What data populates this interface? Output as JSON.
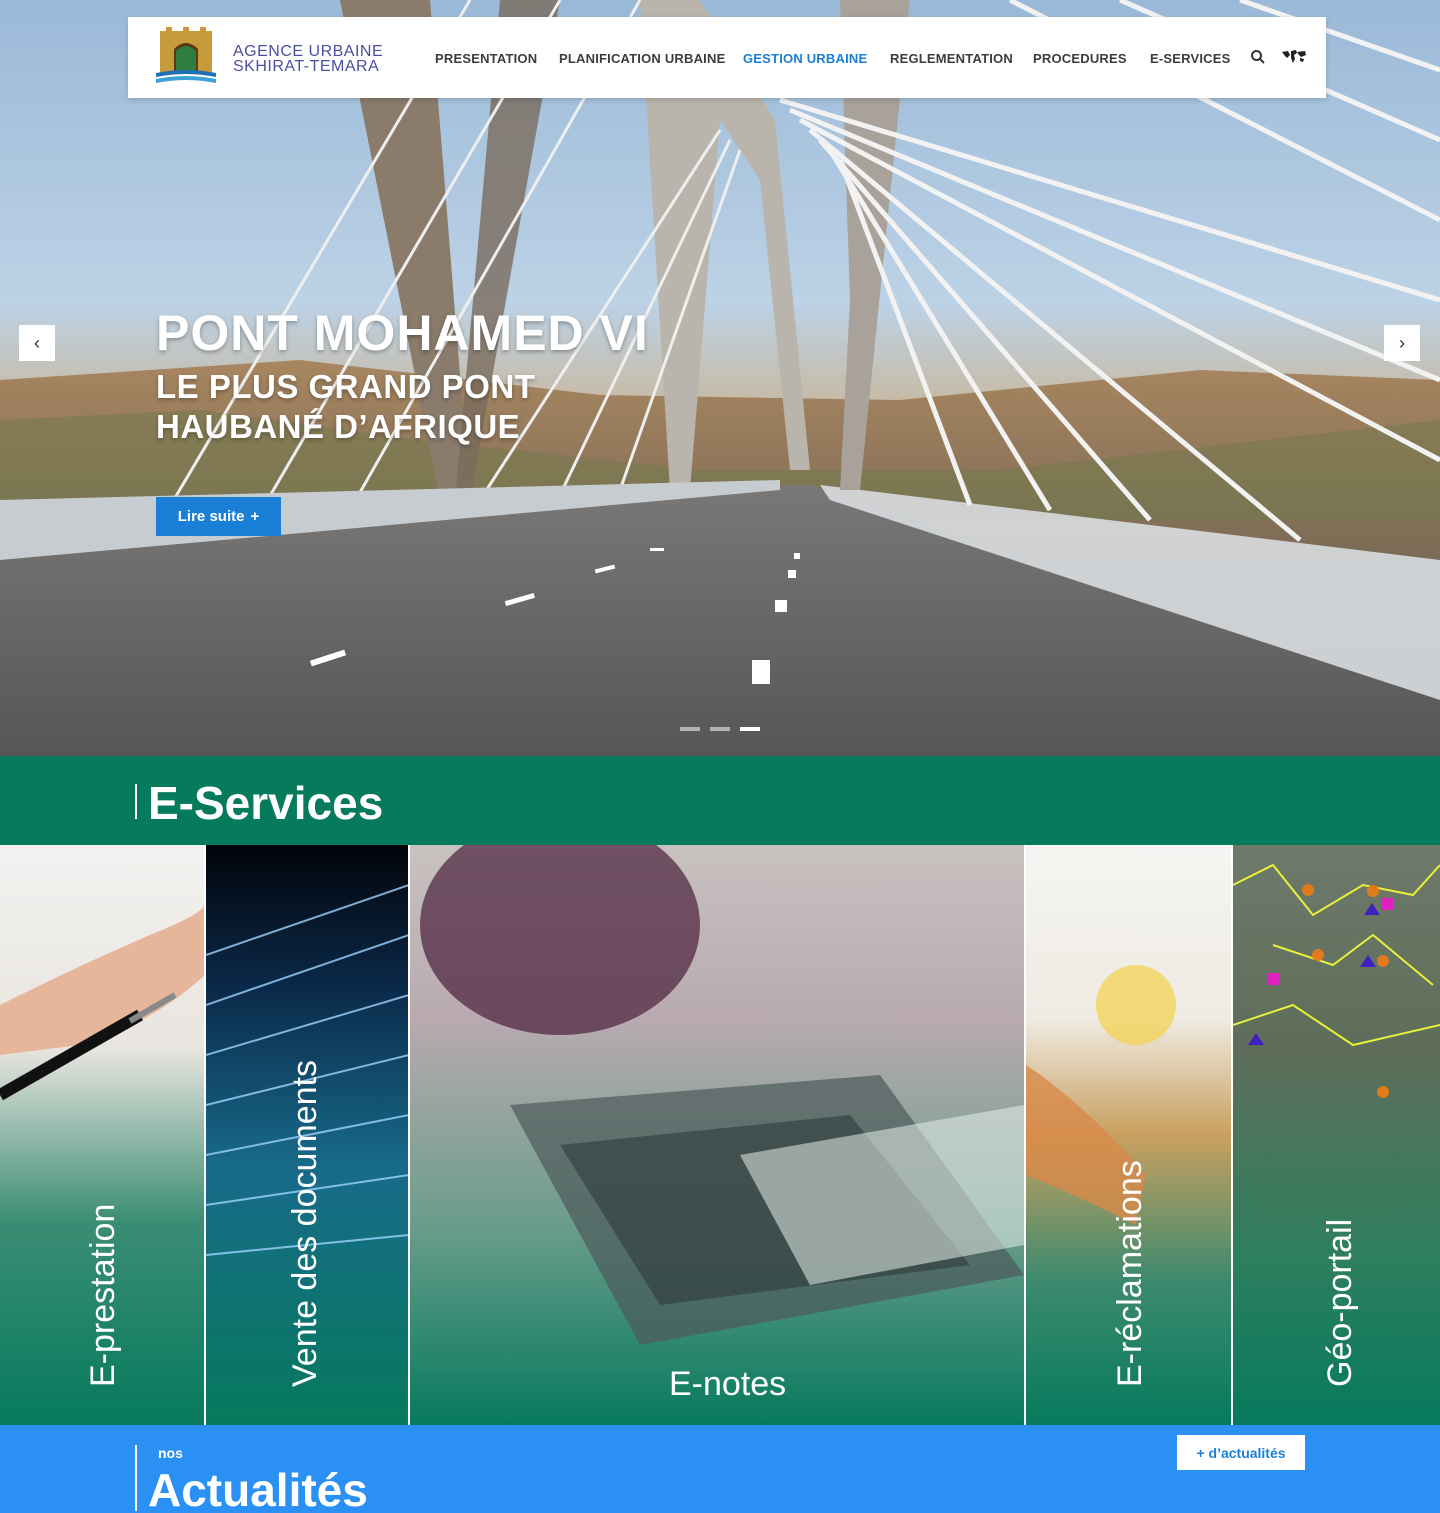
{
  "header": {
    "brand_line1": "AGENCE URBAINE",
    "brand_line2": "SKHIRAT-TEMARA",
    "nav": [
      "PRESENTATION",
      "PLANIFICATION URBAINE",
      "GESTION URBAINE",
      "REGLEMENTATION",
      "PROCEDURES",
      "E-SERVICES"
    ],
    "active_nav": "GESTION URBAINE",
    "icons": [
      "search-icon",
      "world-map-icon"
    ]
  },
  "hero": {
    "title": "PONT MOHAMED VI",
    "subtitle_line1": "LE PLUS GRAND PONT",
    "subtitle_line2": "HAUBANÉ D’AFRIQUE",
    "button_label": "Lire suite",
    "button_icon": "+",
    "slides_count": 3,
    "active_slide": 3,
    "prev_icon": "chevron-left-icon",
    "next_icon": "chevron-right-icon"
  },
  "eservices": {
    "title": "E-Services",
    "items": [
      "E-prestation",
      "Vente des documents",
      "E-notes",
      "E-réclamations",
      "Géo-portail"
    ]
  },
  "actualites": {
    "pre": "nos",
    "title": "Actualités",
    "more_button": "+ d’actualités"
  },
  "colors": {
    "accent_blue": "#1a7fd6",
    "green": "#067a5d",
    "actu_blue": "#2b90f3"
  }
}
